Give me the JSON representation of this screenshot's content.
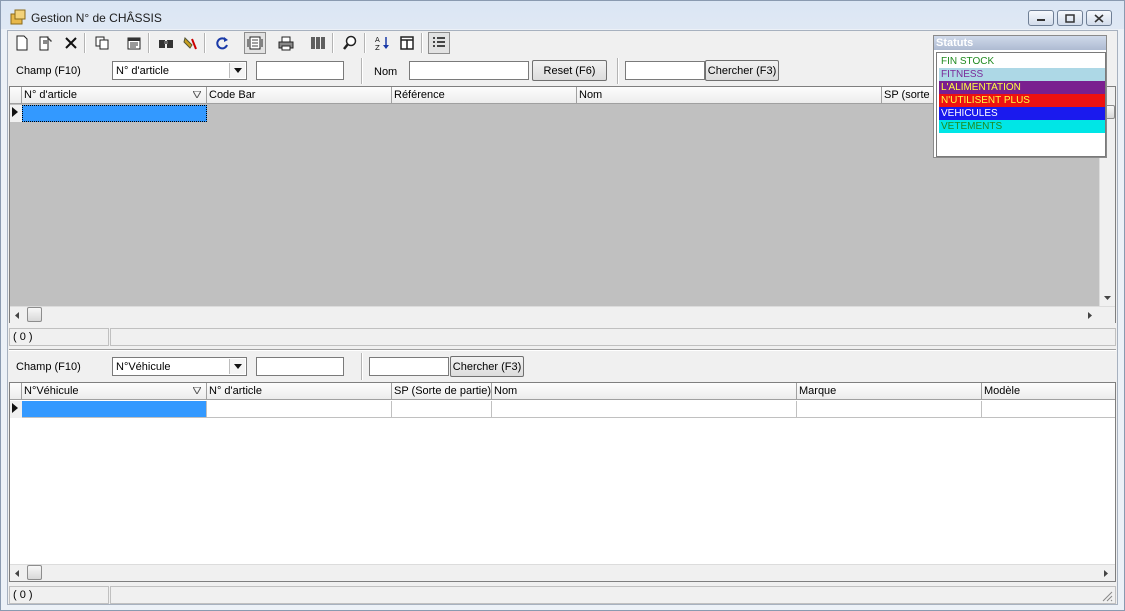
{
  "window": {
    "title": "Gestion N° de CHÂSSIS"
  },
  "toolbar": {
    "items": [
      "new-document-icon",
      "edit-document-icon",
      "delete-icon",
      "copy-icon",
      "properties-icon",
      "find-icon",
      "clear-filter-icon",
      "refresh-icon",
      "view-icon",
      "print-icon",
      "barcode-icon",
      "zoom-icon",
      "sort-az-icon",
      "columns-icon",
      "list-view-icon"
    ]
  },
  "top_filter": {
    "field_label": "Champ (F10)",
    "field_value": "N° d'article",
    "value_input": "",
    "name_label": "Nom",
    "name_input": "",
    "reset_label": "Reset (F6)",
    "search_input": "",
    "search_label": "Chercher (F3)"
  },
  "top_grid": {
    "columns": [
      "N° d'article",
      "Code Bar",
      "Référence",
      "Nom",
      "SP (sorte d"
    ],
    "status": "( 0 )"
  },
  "bottom_filter": {
    "field_label": "Champ (F10)",
    "field_value": "N°Véhicule",
    "value_input": "",
    "search_input": "",
    "search_label": "Chercher (F3)"
  },
  "bottom_grid": {
    "columns": [
      "N°Véhicule",
      "N° d'article",
      "SP (Sorte de partie)",
      "Nom",
      "Marque",
      "Modèle"
    ],
    "status": "( 0 )"
  },
  "statuts": {
    "title": "Statuts",
    "items": [
      {
        "label": "FIN STOCK",
        "fg": "#1f8a1f",
        "bg": "#ffffff"
      },
      {
        "label": "FITNESS",
        "fg": "#7a2a9a",
        "bg": "#add8e6"
      },
      {
        "label": "L'ALIMENTATION",
        "fg": "#ffff40",
        "bg": "#7a1f8f"
      },
      {
        "label": "N'UTILISENT PLUS",
        "fg": "#ffff40",
        "bg": "#ee1111"
      },
      {
        "label": "VEHICULES",
        "fg": "#ffffff",
        "bg": "#1a1aee"
      },
      {
        "label": "VETEMENTS",
        "fg": "#1f8a1f",
        "bg": "#00e6e6"
      }
    ]
  },
  "colors": {
    "selection": "#3399ff",
    "grid_empty": "#c0c0c0"
  }
}
